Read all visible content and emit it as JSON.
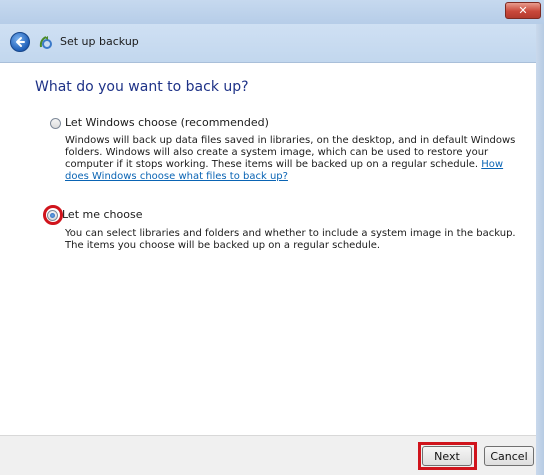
{
  "window": {
    "close_label": "✕",
    "title": "Set up backup"
  },
  "heading": "What do you want to back up?",
  "options": [
    {
      "label": "Let Windows choose (recommended)",
      "selected": false,
      "description": "Windows will back up data files saved in libraries, on the desktop, and in default Windows folders. Windows will also create a system image, which can be used to restore your computer if it stops working. These items will be backed up on a regular schedule.",
      "link": "How does Windows choose what files to back up?"
    },
    {
      "label": "Let me choose",
      "selected": true,
      "description": "You can select libraries and folders and whether to include a system image in the backup. The items you choose will be backed up on a regular schedule."
    }
  ],
  "footer": {
    "next_label": "Next",
    "cancel_label": "Cancel"
  },
  "colors": {
    "heading": "#1e3287",
    "link": "#0a64b4",
    "highlight": "#d0141c"
  },
  "icons": {
    "back": "back-arrow-icon",
    "wizard": "backup-wizard-icon",
    "close": "close-icon"
  }
}
